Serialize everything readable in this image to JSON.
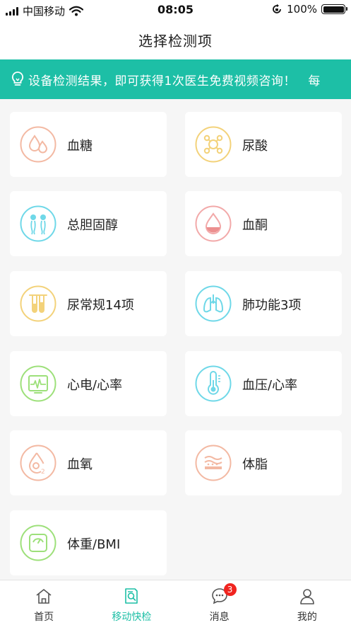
{
  "status_bar": {
    "carrier": "中国移动",
    "time": "08:05",
    "battery": "100%"
  },
  "nav": {
    "title": "选择检测项"
  },
  "notice": {
    "text": "设备检测结果，即可获得1次医生免费视频咨询！　每"
  },
  "items": [
    {
      "label": "血糖",
      "icon": "blood-drops-icon",
      "color": "#f3b9a3"
    },
    {
      "label": "尿酸",
      "icon": "molecule-icon",
      "color": "#f3d27a"
    },
    {
      "label": "总胆固醇",
      "icon": "cholesterol-icon",
      "color": "#6fd8e8"
    },
    {
      "label": "血酮",
      "icon": "blood-drop-half-icon",
      "color": "#f2a9a9"
    },
    {
      "label": "尿常规14项",
      "icon": "test-tubes-icon",
      "color": "#f3d27a"
    },
    {
      "label": "肺功能3项",
      "icon": "lungs-icon",
      "color": "#6fd8e8"
    },
    {
      "label": "心电/心率",
      "icon": "ecg-monitor-icon",
      "color": "#9de07a"
    },
    {
      "label": "血压/心率",
      "icon": "thermometer-icon",
      "color": "#6fd8e8"
    },
    {
      "label": "血氧",
      "icon": "oxygen-drop-icon",
      "color": "#f3b9a3"
    },
    {
      "label": "体脂",
      "icon": "body-fat-icon",
      "color": "#f3b9a3"
    },
    {
      "label": "体重/BMI",
      "icon": "scale-icon",
      "color": "#9de07a"
    }
  ],
  "tabs": [
    {
      "label": "首页",
      "icon": "home-icon"
    },
    {
      "label": "移动快检",
      "icon": "quick-check-icon"
    },
    {
      "label": "消息",
      "icon": "message-icon",
      "badge": "3"
    },
    {
      "label": "我的",
      "icon": "profile-icon"
    }
  ],
  "accent": "#1dbfa6"
}
